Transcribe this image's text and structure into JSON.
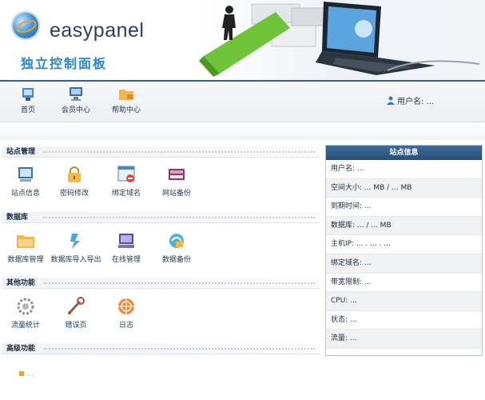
{
  "header": {
    "logo_text": "easypanel",
    "logo_subtitle": "独立控制面板"
  },
  "toolbar": {
    "items": [
      {
        "label": "首页"
      },
      {
        "label": "会员中心"
      },
      {
        "label": "帮助中心"
      }
    ],
    "user_info": "用户名: ..."
  },
  "sections": [
    {
      "title": "站点管理",
      "items": [
        {
          "label": "站点信息"
        },
        {
          "label": "密码修改"
        },
        {
          "label": "绑定域名"
        },
        {
          "label": "网站备份"
        }
      ]
    },
    {
      "title": "数据库",
      "items": [
        {
          "label": "数据库管理"
        },
        {
          "label": "数据库导入导出"
        },
        {
          "label": "在线管理"
        },
        {
          "label": "数据备份"
        }
      ]
    },
    {
      "title": "其他功能",
      "items": [
        {
          "label": "流量统计"
        },
        {
          "label": "错误页"
        },
        {
          "label": "日志"
        }
      ]
    },
    {
      "title": "高级功能",
      "items": []
    }
  ],
  "right_panel": {
    "title": "站点信息",
    "rows": [
      "用户名: ...",
      "空间大小: ... MB / ... MB",
      "到期时间: ...",
      "数据库: ... / ... MB",
      "主机IP: ... . ... . ...",
      "绑定域名: ...",
      "带宽限制: ...",
      "CPU: ...",
      "状态: ...",
      "流量: ..."
    ]
  },
  "footer": {
    "text": "..."
  },
  "colors": {
    "accent": "#3b5f86",
    "panel_head": "#2c5780",
    "link": "#243a55"
  }
}
